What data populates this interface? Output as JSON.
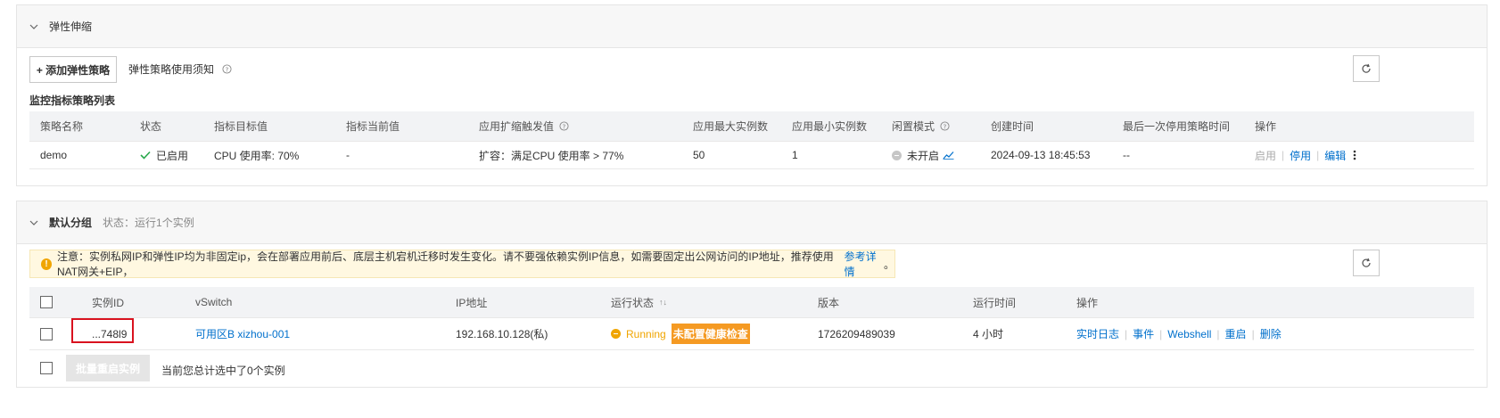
{
  "elastic_panel": {
    "title": "弹性伸缩",
    "add_policy_label": "+ 添加弹性策略",
    "policy_notice_label": "弹性策略使用须知",
    "list_title": "监控指标策略列表",
    "columns": [
      "策略名称",
      "状态",
      "指标目标值",
      "指标当前值",
      "应用扩缩触发值",
      "应用最大实例数",
      "应用最小实例数",
      "闲置模式",
      "创建时间",
      "最后一次停用策略时间",
      "操作"
    ],
    "row": {
      "name": "demo",
      "status": "已启用",
      "target": "CPU 使用率: 70%",
      "current": "-",
      "trigger": "扩容：满足CPU 使用率 > 77%",
      "max_instances": "50",
      "min_instances": "1",
      "idle_mode": "未开启",
      "created": "2024-09-13 18:45:53",
      "last_disable": "--",
      "actions": {
        "enable": "启用",
        "disable": "停用",
        "edit": "编辑"
      }
    }
  },
  "group_panel": {
    "title": "默认分组",
    "status_text": "状态：运行1个实例",
    "notice_text": "注意：实例私网IP和弹性IP均为非固定ip，会在部署应用前后、底层主机宕机迁移时发生变化。请不要强依赖实例IP信息，如需要固定出公网访问的IP地址，推荐使用NAT网关+EIP，",
    "notice_link": "参考详情",
    "notice_end": "。",
    "columns": {
      "instance_id": "实例ID",
      "vswitch": "vSwitch",
      "ip": "IP地址",
      "run_status": "运行状态",
      "version": "版本",
      "run_time": "运行时间",
      "actions": "操作"
    },
    "sort_glyph": "↑↓",
    "row": {
      "instance_id": "...748l9",
      "vswitch": "可用区B xizhou-001",
      "ip": "192.168.10.128(私)",
      "status": "Running",
      "badge": "未配置健康检查",
      "version": "1726209489039",
      "run_time": "4 小时",
      "actions": [
        "实时日志",
        "事件",
        "Webshell",
        "重启",
        "删除"
      ]
    },
    "batch_restart_label": "批量重启实例",
    "selected_text": "当前您总计选中了0个实例"
  }
}
